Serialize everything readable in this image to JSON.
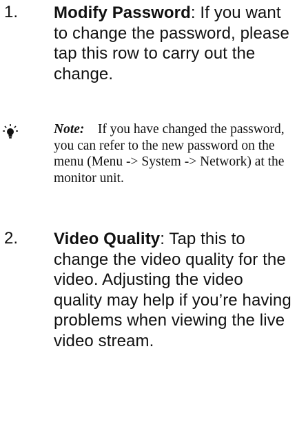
{
  "items": [
    {
      "number": "1.",
      "term": "Modify Password",
      "separator": ":",
      "text": "  If you want to change the password, please tap this row to carry out the change."
    },
    {
      "number": "2.",
      "term": "Video Quality",
      "separator": ":",
      "text": "  Tap this to change the video quality for the video. Adjusting the video quality may help if you’re having problems when viewing the live video stream."
    }
  ],
  "note": {
    "icon": "lightbulb-icon",
    "label": "Note:",
    "text": "    If you have changed the password, you can refer to the new password on the menu (Menu -> System -> Network) at the monitor unit."
  }
}
